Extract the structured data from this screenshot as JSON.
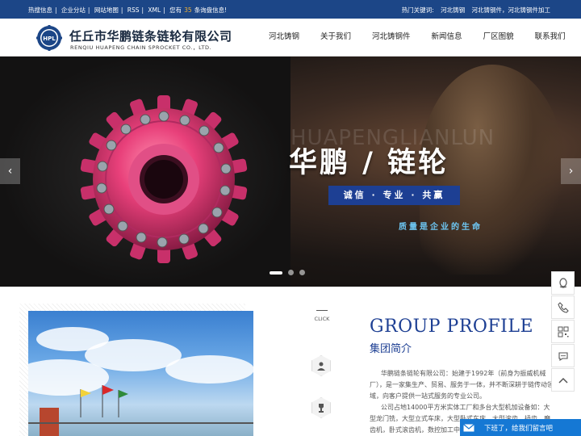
{
  "topbar": {
    "links": [
      "热搜信息",
      "企业分站",
      "网站地图",
      "RSS",
      "XML"
    ],
    "notice_prefix": "您有",
    "notice_count": "35",
    "notice_suffix": "条询盘信息!",
    "hot_label": "热门关键词:",
    "hot_keywords": [
      "河北铸钢",
      "河北铸钢件，河北铸钢件加工"
    ]
  },
  "header": {
    "logo_text": "HPL",
    "company_name": "任丘市华鹏链条链轮有限公司",
    "company_name_en": "RENQIU HUAPENG CHAIN SPROCKET CO.，LTD."
  },
  "nav": {
    "items": [
      "河北铸钢",
      "关于我们",
      "河北铸钢件",
      "新闻信息",
      "厂区图貌",
      "联系我们"
    ]
  },
  "banner": {
    "bg_letters": "HUAPENGLIANLUN",
    "slogan": "华鹏 / 链轮",
    "motto": "诚信 · 专业 · 共赢",
    "tagline": "质量是企业的生命",
    "prev_arrow": "‹",
    "next_arrow": "›",
    "slides": 3,
    "active_slide": 1
  },
  "profile": {
    "click_label": "CLICK",
    "title_en": "GROUP PROFILE",
    "title_cn": "集团简介",
    "paragraph1": "华鹏链条链轮有限公司：始建于1992年（前身为振威机械厂），是一家集生产、贸易、服务于一体，并不断深耕于链传动领域，向客户提供一站式服务的专业公司。",
    "paragraph2": "公司占地14000平方米实体工厂和多台大型机加设备如：大型龙门铣，大型立式车床，大型卧式车床，大型滚齿，插齿，磨齿机，卧式滚齿机，数控加工中心等"
  },
  "sidebar": {
    "buttons": [
      "qq-icon",
      "phone-icon",
      "qrcode-icon",
      "wechat-icon",
      "back-to-top-icon"
    ]
  },
  "message_bar": {
    "text": "下班了，给我们留言吧"
  },
  "colors": {
    "brand_blue": "#1c4687",
    "accent_blue": "#1d3f93",
    "message_blue": "#1578d4",
    "highlight": "#f2b233"
  }
}
